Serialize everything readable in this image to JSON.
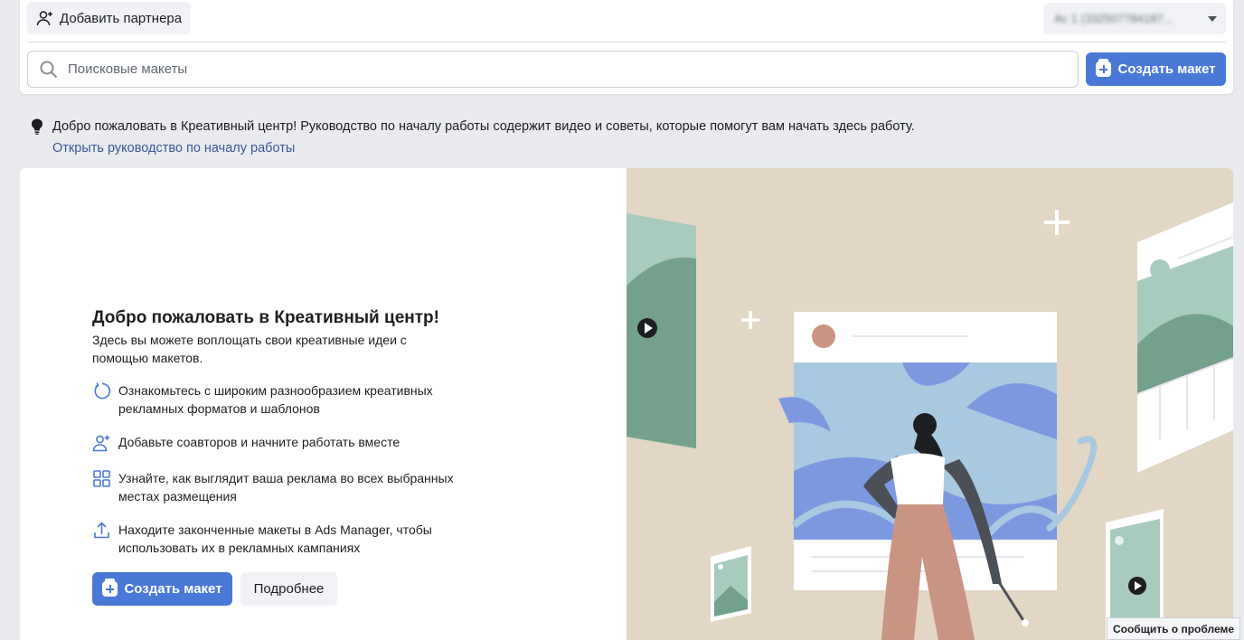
{
  "header": {
    "add_partner_label": "Добавить партнера",
    "account_selector_value": "Ac 1 (332507784187...",
    "search_placeholder": "Поисковые макеты",
    "create_button_label": "Создать макет"
  },
  "notice": {
    "message": "Добро пожаловать в Креативный центр! Руководство по началу работы содержит видео и советы, которые помогут вам начать здесь работу.",
    "link_label": "Открыть руководство по началу работы"
  },
  "welcome": {
    "title": "Добро пожаловать в Креативный центр!",
    "subtitle": "Здесь вы можете воплощать свои креативные идеи с помощью макетов.",
    "features": [
      {
        "icon": "refresh-icon",
        "text": "Ознакомьтесь с широким разнообразием креативных рекламных форматов и шаблонов"
      },
      {
        "icon": "add-person-icon",
        "text": "Добавьте соавторов и начните работать вместе"
      },
      {
        "icon": "grid-icon",
        "text": "Узнайте, как выглядит ваша реклама во всех выбранных местах размещения"
      },
      {
        "icon": "upload-icon",
        "text": "Находите законченные макеты в Ads Manager, чтобы использовать их в рекламных кампаниях"
      }
    ],
    "create_button_label": "Создать макет",
    "more_button_label": "Подробнее"
  },
  "report_problem_label": "Сообщить о проблеме",
  "colors": {
    "accent": "#4a78d6",
    "link": "#385898",
    "illustration_bg": "#e2d6c4"
  }
}
